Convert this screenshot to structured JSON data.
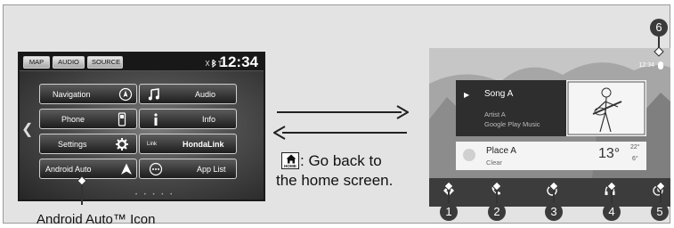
{
  "head_unit": {
    "tabs": [
      "MAP",
      "AUDIO",
      "SOURCE"
    ],
    "clock": "12:34",
    "status_icons": "bluetooth-icon signal-icon",
    "buttons": [
      {
        "label": "Navigation",
        "icon": "compass-icon"
      },
      {
        "label": "Audio",
        "icon": "music-note-icon"
      },
      {
        "label": "Phone",
        "icon": "phone-icon"
      },
      {
        "label": "Info",
        "icon": "info-icon"
      },
      {
        "label": "Settings",
        "icon": "gear-icon"
      },
      {
        "label": "HondaLink",
        "icon": "link-icon"
      },
      {
        "label": "Android Auto",
        "icon": "android-auto-icon"
      },
      {
        "label": "App List",
        "icon": "app-list-icon"
      }
    ],
    "link_icon_text": "Link",
    "page_dots": "• • • • •"
  },
  "middle": {
    "home_key_label": "HOME",
    "home_text_line1": ": Go back to",
    "home_text_line2": "the home screen."
  },
  "android_auto": {
    "status_time": "12:34",
    "media": {
      "song": "Song A",
      "artist": "Artist A",
      "service": "Google Play Music"
    },
    "weather": {
      "place": "Place A",
      "condition": "Clear",
      "temp": "13°",
      "high": "22°",
      "low": "6°"
    },
    "nav_icons": [
      "navigation-icon",
      "phone-icon",
      "home-circle-icon",
      "headphones-icon",
      "recent-clock-icon"
    ]
  },
  "callouts": [
    "1",
    "2",
    "3",
    "4",
    "5",
    "6"
  ],
  "label": "Android Auto™ Icon",
  "colors": {
    "frame": "#e3e3e3",
    "callout": "#3b3b3b",
    "dark_card": "#2e2e2e"
  }
}
